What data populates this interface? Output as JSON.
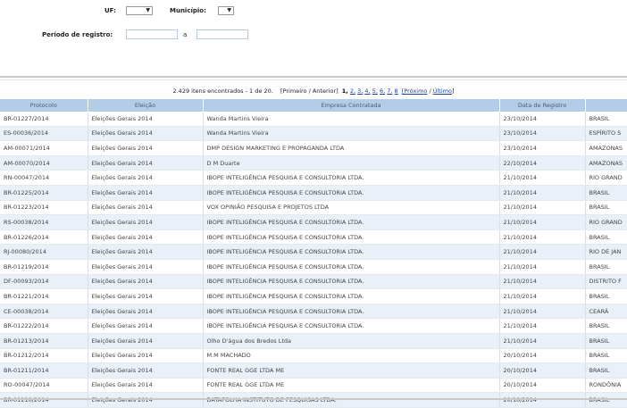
{
  "filters": {
    "uf_label": "UF:",
    "uf_value": "▼",
    "municipio_label": "Município:",
    "municipio_value": "▼",
    "periodo_label": "Período de registro:",
    "periodo_start": "",
    "periodo_separator": "a",
    "periodo_end": ""
  },
  "pager": {
    "summary": "2.429 itens encontrados - 1 de 20.",
    "first_prev": "[Primeiro / Anterior]",
    "current": "1,",
    "pages": [
      "2,",
      "3,",
      "4,",
      "5,",
      "6,",
      "7,",
      "8"
    ],
    "next_label": "[Próximo",
    "slash": " / ",
    "last_label": "Último",
    "close_bracket": "]"
  },
  "table": {
    "headers": [
      "Protocolo",
      "Eleição",
      "Empresa Contratada",
      "Data de Registro",
      ""
    ],
    "rows": [
      [
        "BR-01227/2014",
        "Eleições Gerais 2014",
        "Wanda Martins Vieira",
        "23/10/2014",
        "BRASIL"
      ],
      [
        "ES-00036/2014",
        "Eleições Gerais 2014",
        "Wanda Martins Vieira",
        "23/10/2014",
        "ESPÍRITO S"
      ],
      [
        "AM-00071/2014",
        "Eleições Gerais 2014",
        "DMP DESIGN MARKETING E PROPAGANDA LTDA",
        "23/10/2014",
        "AMAZONAS"
      ],
      [
        "AM-00070/2014",
        "Eleições Gerais 2014",
        "D M Duarte",
        "22/10/2014",
        "AMAZONAS"
      ],
      [
        "RN-00047/2014",
        "Eleições Gerais 2014",
        "IBOPE INTELIGÊNCIA PESQUISA E CONSULTORIA LTDA.",
        "21/10/2014",
        "RIO GRAND"
      ],
      [
        "BR-01225/2014",
        "Eleições Gerais 2014",
        "IBOPE INTELIGÊNCIA PESQUISA E CONSULTORIA LTDA.",
        "21/10/2014",
        "BRASIL"
      ],
      [
        "BR-01223/2014",
        "Eleições Gerais 2014",
        "VOX OPINIÃO PESQUISA E PROJETOS LTDA",
        "21/10/2014",
        "BRASIL"
      ],
      [
        "RS-00038/2014",
        "Eleições Gerais 2014",
        "IBOPE INTELIGÊNCIA PESQUISA E CONSULTORIA LTDA.",
        "21/10/2014",
        "RIO GRAND"
      ],
      [
        "BR-01226/2014",
        "Eleições Gerais 2014",
        "IBOPE INTELIGÊNCIA PESQUISA E CONSULTORIA LTDA.",
        "21/10/2014",
        "BRASIL"
      ],
      [
        "RJ-00080/2014",
        "Eleições Gerais 2014",
        "IBOPE INTELIGÊNCIA PESQUISA E CONSULTORIA LTDA.",
        "21/10/2014",
        "RIO DE JAN"
      ],
      [
        "BR-01219/2014",
        "Eleições Gerais 2014",
        "IBOPE INTELIGÊNCIA PESQUISA E CONSULTORIA LTDA.",
        "21/10/2014",
        "BRASIL"
      ],
      [
        "DF-00093/2014",
        "Eleições Gerais 2014",
        "IBOPE INTELIGÊNCIA PESQUISA E CONSULTORIA LTDA.",
        "21/10/2014",
        "DISTRITO F"
      ],
      [
        "BR-01221/2014",
        "Eleições Gerais 2014",
        "IBOPE INTELIGÊNCIA PESQUISA E CONSULTORIA LTDA.",
        "21/10/2014",
        "BRASIL"
      ],
      [
        "CE-00038/2014",
        "Eleições Gerais 2014",
        "IBOPE INTELIGÊNCIA PESQUISA E CONSULTORIA LTDA.",
        "21/10/2014",
        "CEARÁ"
      ],
      [
        "BR-01222/2014",
        "Eleições Gerais 2014",
        "IBOPE INTELIGÊNCIA PESQUISA E CONSULTORIA LTDA.",
        "21/10/2014",
        "BRASIL"
      ],
      [
        "BR-01213/2014",
        "Eleições Gerais 2014",
        "Olho D'água dos Bredos Ltda",
        "21/10/2014",
        "BRASIL"
      ],
      [
        "BR-01212/2014",
        "Eleições Gerais 2014",
        "M.M MACHADO",
        "20/10/2014",
        "BRASIL"
      ],
      [
        "BR-01211/2014",
        "Eleições Gerais 2014",
        "FONTE REAL GGE LTDA ME",
        "20/10/2014",
        "BRASIL"
      ],
      [
        "RO-00047/2014",
        "Eleições Gerais 2014",
        "FONTE REAL GGE LTDA ME",
        "20/10/2014",
        "RONDÔNIA"
      ],
      [
        "BR-01210/2014",
        "Eleições Gerais 2014",
        "DATAFOLHA INSTITUTO DE PESQUISAS LTDA.",
        "20/10/2014",
        "BRASIL"
      ]
    ]
  }
}
